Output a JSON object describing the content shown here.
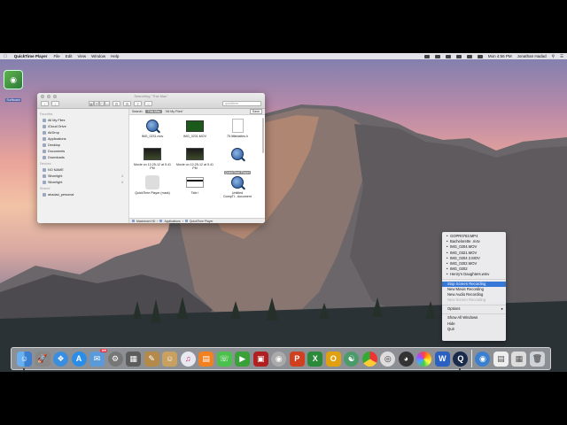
{
  "menubar": {
    "app_name": "QuickTime Player",
    "items": [
      "File",
      "Edit",
      "View",
      "Window",
      "Help"
    ],
    "clock": "Mon 4:56 PM",
    "user": "Jonathan Hadad"
  },
  "desktop": {
    "icon_label": "Surfboard"
  },
  "finder": {
    "title": "Searching \"This Mac\"",
    "search_placeholder": "quicktime",
    "scope": {
      "search_label": "Search:",
      "this_mac": "This Mac",
      "all_my_files": "\"All My Files\"",
      "save": "Save"
    },
    "sidebar": {
      "favorites_header": "Favorites",
      "favorites": [
        "All My Files",
        "iCloud Drive",
        "AirDrop",
        "Applications",
        "Desktop",
        "Documents",
        "Downloads"
      ],
      "devices_header": "Devices",
      "devices": [
        {
          "label": "NO NAME",
          "count": ""
        },
        {
          "label": "Silverlight",
          "count": "4"
        },
        {
          "label": "Silverlight",
          "count": "4"
        }
      ],
      "shared_header": "Shared",
      "shared": [
        "ahadad_personal"
      ]
    },
    "files": [
      {
        "label": "IMG_0231.mov",
        "kind": "qt"
      },
      {
        "label": "IMG_0231.MOV",
        "kind": "vid"
      },
      {
        "label": "75.littledaites.h",
        "kind": "doc"
      },
      {
        "label": "Movie on 12-25-12 at 5.41 PM",
        "kind": "pic"
      },
      {
        "label": "Movie on 12-25-12 at 5.41 PM",
        "kind": "pic"
      },
      {
        "label": "QuickTime Player",
        "kind": "qt",
        "selected": true
      },
      {
        "label": "QuickTime Player (mark)",
        "kind": "clr"
      },
      {
        "label": "Tide I",
        "kind": "bar"
      },
      {
        "label": "Untitled DumpTI...document",
        "kind": "qt"
      }
    ],
    "pathbar": [
      "Macintosh HD",
      "Applications",
      "QuickTime Player"
    ]
  },
  "context_menu": {
    "recent": [
      "GOPR0763.MP4",
      "Bachelorette .m4v",
      "IMG_0204.MOV",
      "IMG_0321.MOV",
      "IMG_0204 2.MOV",
      "IMG_0202.MOV",
      "IMG_0202",
      "Henry's Daughters.wmv"
    ],
    "actions": [
      "Stop Screen Recording",
      "New Movie Recording",
      "New Audio Recording",
      "New Screen Recording"
    ],
    "options": "Options",
    "window_items": [
      "Show All Windows",
      "Hide",
      "Quit"
    ]
  },
  "dock": {
    "mail_badge": "169"
  }
}
